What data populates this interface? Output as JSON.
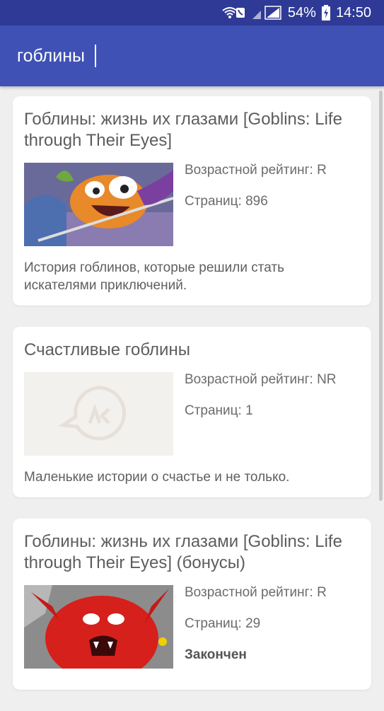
{
  "status_bar": {
    "battery": "54%",
    "time": "14:50"
  },
  "search": {
    "value": "гоблины"
  },
  "results": [
    {
      "title": "Гоблины: жизнь их глазами [Goblins: Life through Their Eyes]",
      "rating": "Возрастной рейтинг: R",
      "pages": "Страниц: 896",
      "description": "История гоблинов, которые решили стать искателями приключений."
    },
    {
      "title": "Счастливые гоблины",
      "rating": "Возрастной рейтинг: NR",
      "pages": "Страниц: 1",
      "description": "Маленькие истории о счастье и не только."
    },
    {
      "title": "Гоблины: жизнь их глазами [Goblins: Life through Their Eyes] (бонусы)",
      "rating": "Возрастной рейтинг: R",
      "pages": "Страниц: 29",
      "status": "Закончен"
    }
  ]
}
